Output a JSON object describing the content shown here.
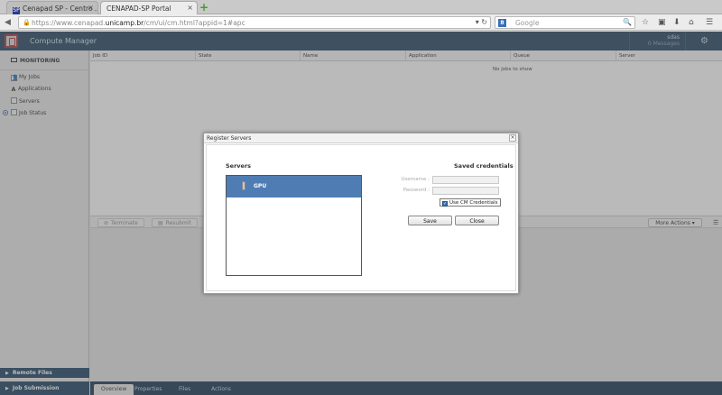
{
  "browser": {
    "tabs": [
      {
        "title": "Cenapad SP - Centro ...",
        "favicon": "SP",
        "active": false
      },
      {
        "title": "CENAPAD-SP Portal",
        "active": true
      }
    ],
    "tab_close_glyph": "×",
    "new_tab_glyph": "+",
    "url_prefix": "https://www.cenapad.",
    "url_host": "unicamp.br",
    "url_path": "/cm/ui/cm.html?appid=1#apc",
    "search_placeholder": "Google",
    "search_engine_badge": "8"
  },
  "app": {
    "title": "Compute Manager",
    "user": "sdas",
    "messages": "0 Messages"
  },
  "sidebar": {
    "monitoring_label": "MONITORING",
    "items": [
      {
        "label": "My Jobs",
        "icon": "user-icon"
      },
      {
        "label": "Applications",
        "icon": "app-a-icon"
      },
      {
        "label": "Servers",
        "icon": "server-icon"
      },
      {
        "label": "Job Status",
        "icon": "status-icon"
      }
    ],
    "remote_files_label": "Remote Files",
    "job_submission_label": "Job Submission"
  },
  "job_table": {
    "columns": [
      "Job ID",
      "State",
      "Name",
      "Application",
      "Queue",
      "Server"
    ],
    "empty_message": "No jobs to show"
  },
  "action_bar": {
    "terminate_label": "Terminate",
    "resubmit_label": "Resubmit",
    "more_actions_label": "More Actions ▾"
  },
  "bottom_tabs": [
    "Overview",
    "Properties",
    "Files",
    "Actions"
  ],
  "modal": {
    "title": "Register Servers",
    "servers_label": "Servers",
    "servers": [
      "GPU"
    ],
    "saved_credentials_label": "Saved credentials",
    "username_label": "Username :",
    "password_label": "Password :",
    "username_value": "",
    "password_value": "",
    "use_cm_credentials_label": "Use CM Credentials",
    "use_cm_credentials_checked": true,
    "save_label": "Save",
    "close_label": "Close"
  },
  "colors": {
    "header_bg": "#2b4966",
    "selection_blue": "#4f7db3",
    "section_bar": "#244766"
  }
}
